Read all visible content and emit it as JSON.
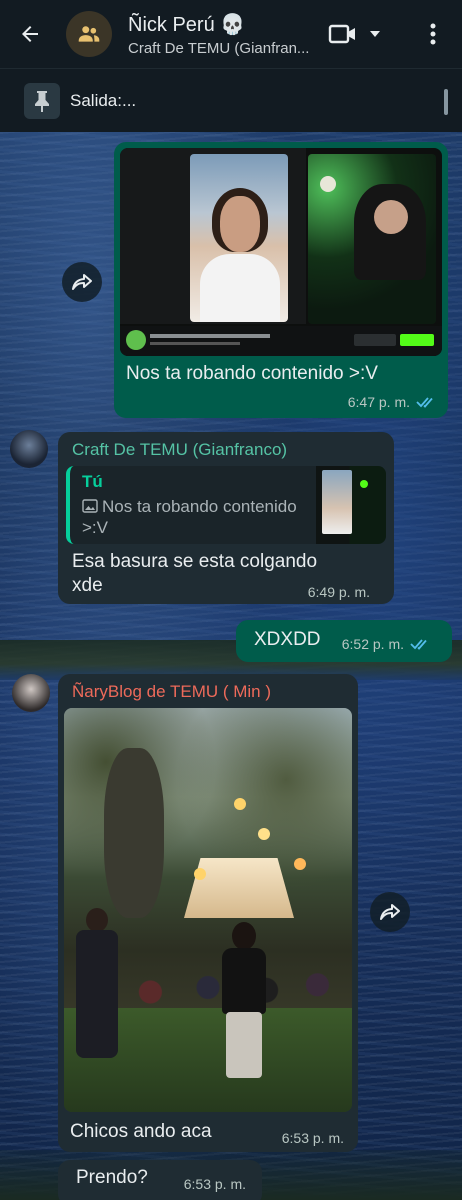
{
  "header": {
    "title": "Ñick Perú 💀",
    "subtitle": "Craft De TEMU (Gianfran..."
  },
  "pinned": {
    "text": "Salida:..."
  },
  "messages": [
    {
      "direction": "outgoing",
      "text": "Nos ta robando contenido >:V",
      "time": "6:47 p. m.",
      "status": "read"
    },
    {
      "direction": "incoming",
      "sender": "Craft De TEMU (Gianfranco)",
      "sender_color": "#55c3a5",
      "quote": {
        "author": "Tú",
        "text": "Nos ta robando contenido >:V"
      },
      "text": "Esa basura se esta colgando xde",
      "time": "6:49 p. m."
    },
    {
      "direction": "outgoing",
      "text": "XDXDD",
      "time": "6:52 p. m.",
      "status": "read"
    },
    {
      "direction": "incoming",
      "sender": "ÑaryBlog de TEMU ( Min )",
      "sender_color": "#ed6a5a",
      "text": "Chicos ando aca",
      "time": "6:53 p. m."
    },
    {
      "direction": "incoming",
      "text": "Prendo?",
      "time": "6:53 p. m."
    }
  ],
  "colors": {
    "header_bg": "#121b22",
    "outgoing_bubble": "#005c4b",
    "incoming_bubble": "#1f2c33",
    "read_ticks": "#53bdeb"
  },
  "icons": [
    "back-arrow-icon",
    "group-avatar-icon",
    "video-call-icon",
    "chevron-down-icon",
    "more-vert-icon",
    "pin-icon",
    "forward-icon",
    "double-check-icon",
    "image-icon"
  ]
}
